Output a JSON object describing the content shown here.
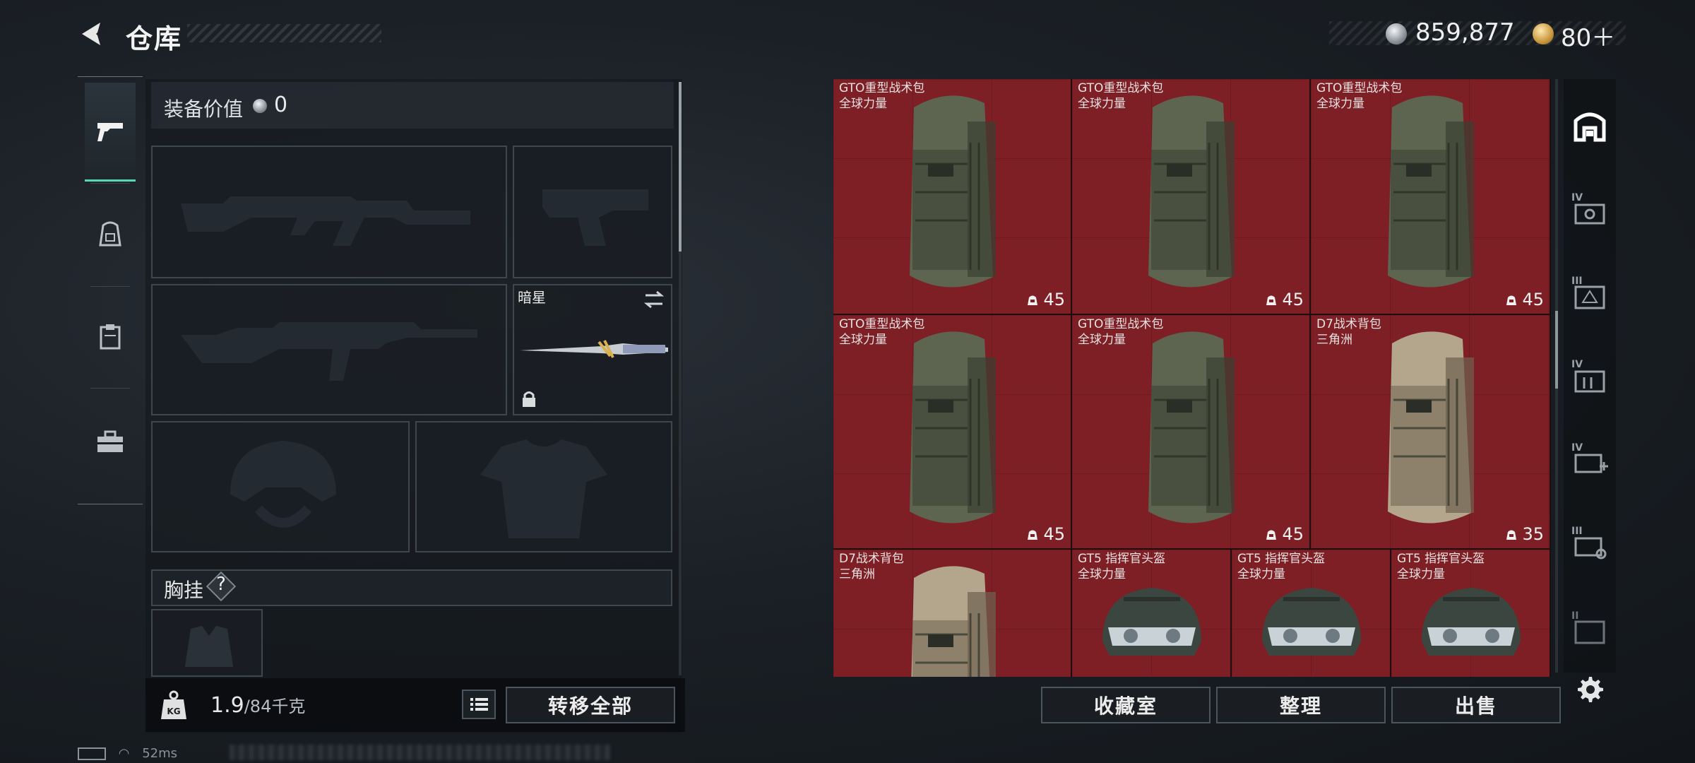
{
  "header": {
    "title": "仓库",
    "currency_value": "859,877",
    "tickets": "80＋"
  },
  "left_rail": {
    "items": [
      {
        "icon": "pistol-icon",
        "active": true
      },
      {
        "icon": "backpack-icon",
        "active": false
      },
      {
        "icon": "clipboard-icon",
        "active": false
      },
      {
        "icon": "toolbox-icon",
        "active": false
      }
    ]
  },
  "loadout": {
    "equip_value_label": "装备价值",
    "equip_value": "0",
    "melee_name": "暗星",
    "chest_rig_label": "胸挂",
    "help_symbol": "?",
    "weight_value": "1.9",
    "weight_max": "/84千克",
    "transfer_all_label": "转移全部"
  },
  "stash": {
    "items": [
      {
        "name": "GTO重型战术包",
        "sub": "全球力量",
        "capacity": "45",
        "type": "backpack-green"
      },
      {
        "name": "GTO重型战术包",
        "sub": "全球力量",
        "capacity": "45",
        "type": "backpack-green"
      },
      {
        "name": "GTO重型战术包",
        "sub": "全球力量",
        "capacity": "45",
        "type": "backpack-green"
      },
      {
        "name": "GTO重型战术包",
        "sub": "全球力量",
        "capacity": "45",
        "type": "backpack-green"
      },
      {
        "name": "GTO重型战术包",
        "sub": "全球力量",
        "capacity": "45",
        "type": "backpack-green"
      },
      {
        "name": "D7战术背包",
        "sub": "三角洲",
        "capacity": "35",
        "type": "backpack-tan"
      },
      {
        "name": "D7战术背包",
        "sub": "三角洲",
        "capacity": "",
        "type": "backpack-tan"
      },
      {
        "name": "GT5 指挥官头盔",
        "sub": "全球力量",
        "capacity": "",
        "type": "helmet"
      },
      {
        "name": "GT5 指挥官头盔",
        "sub": "全球力量",
        "capacity": "",
        "type": "helmet"
      },
      {
        "name": "GT5 指挥官头盔",
        "sub": "全球力量",
        "capacity": "",
        "type": "helmet"
      }
    ],
    "collection_label": "收藏室",
    "sort_label": "整理",
    "sell_label": "出售"
  },
  "right_rail": {
    "items": [
      {
        "icon": "stash-home-icon",
        "tag": ""
      },
      {
        "icon": "safebox-iv-icon",
        "tag": "IV"
      },
      {
        "icon": "box-iii-icon",
        "tag": "III"
      },
      {
        "icon": "case-iv-icon",
        "tag": "IV"
      },
      {
        "icon": "medkit-iv-icon",
        "tag": "IV"
      },
      {
        "icon": "tools-iii-icon",
        "tag": "III"
      },
      {
        "icon": "crate-icon",
        "tag": ""
      }
    ]
  },
  "status_bar": {
    "ping": "52ms"
  },
  "colors": {
    "accent": "#59d6b4",
    "stash_bg": "#7e1f25"
  }
}
